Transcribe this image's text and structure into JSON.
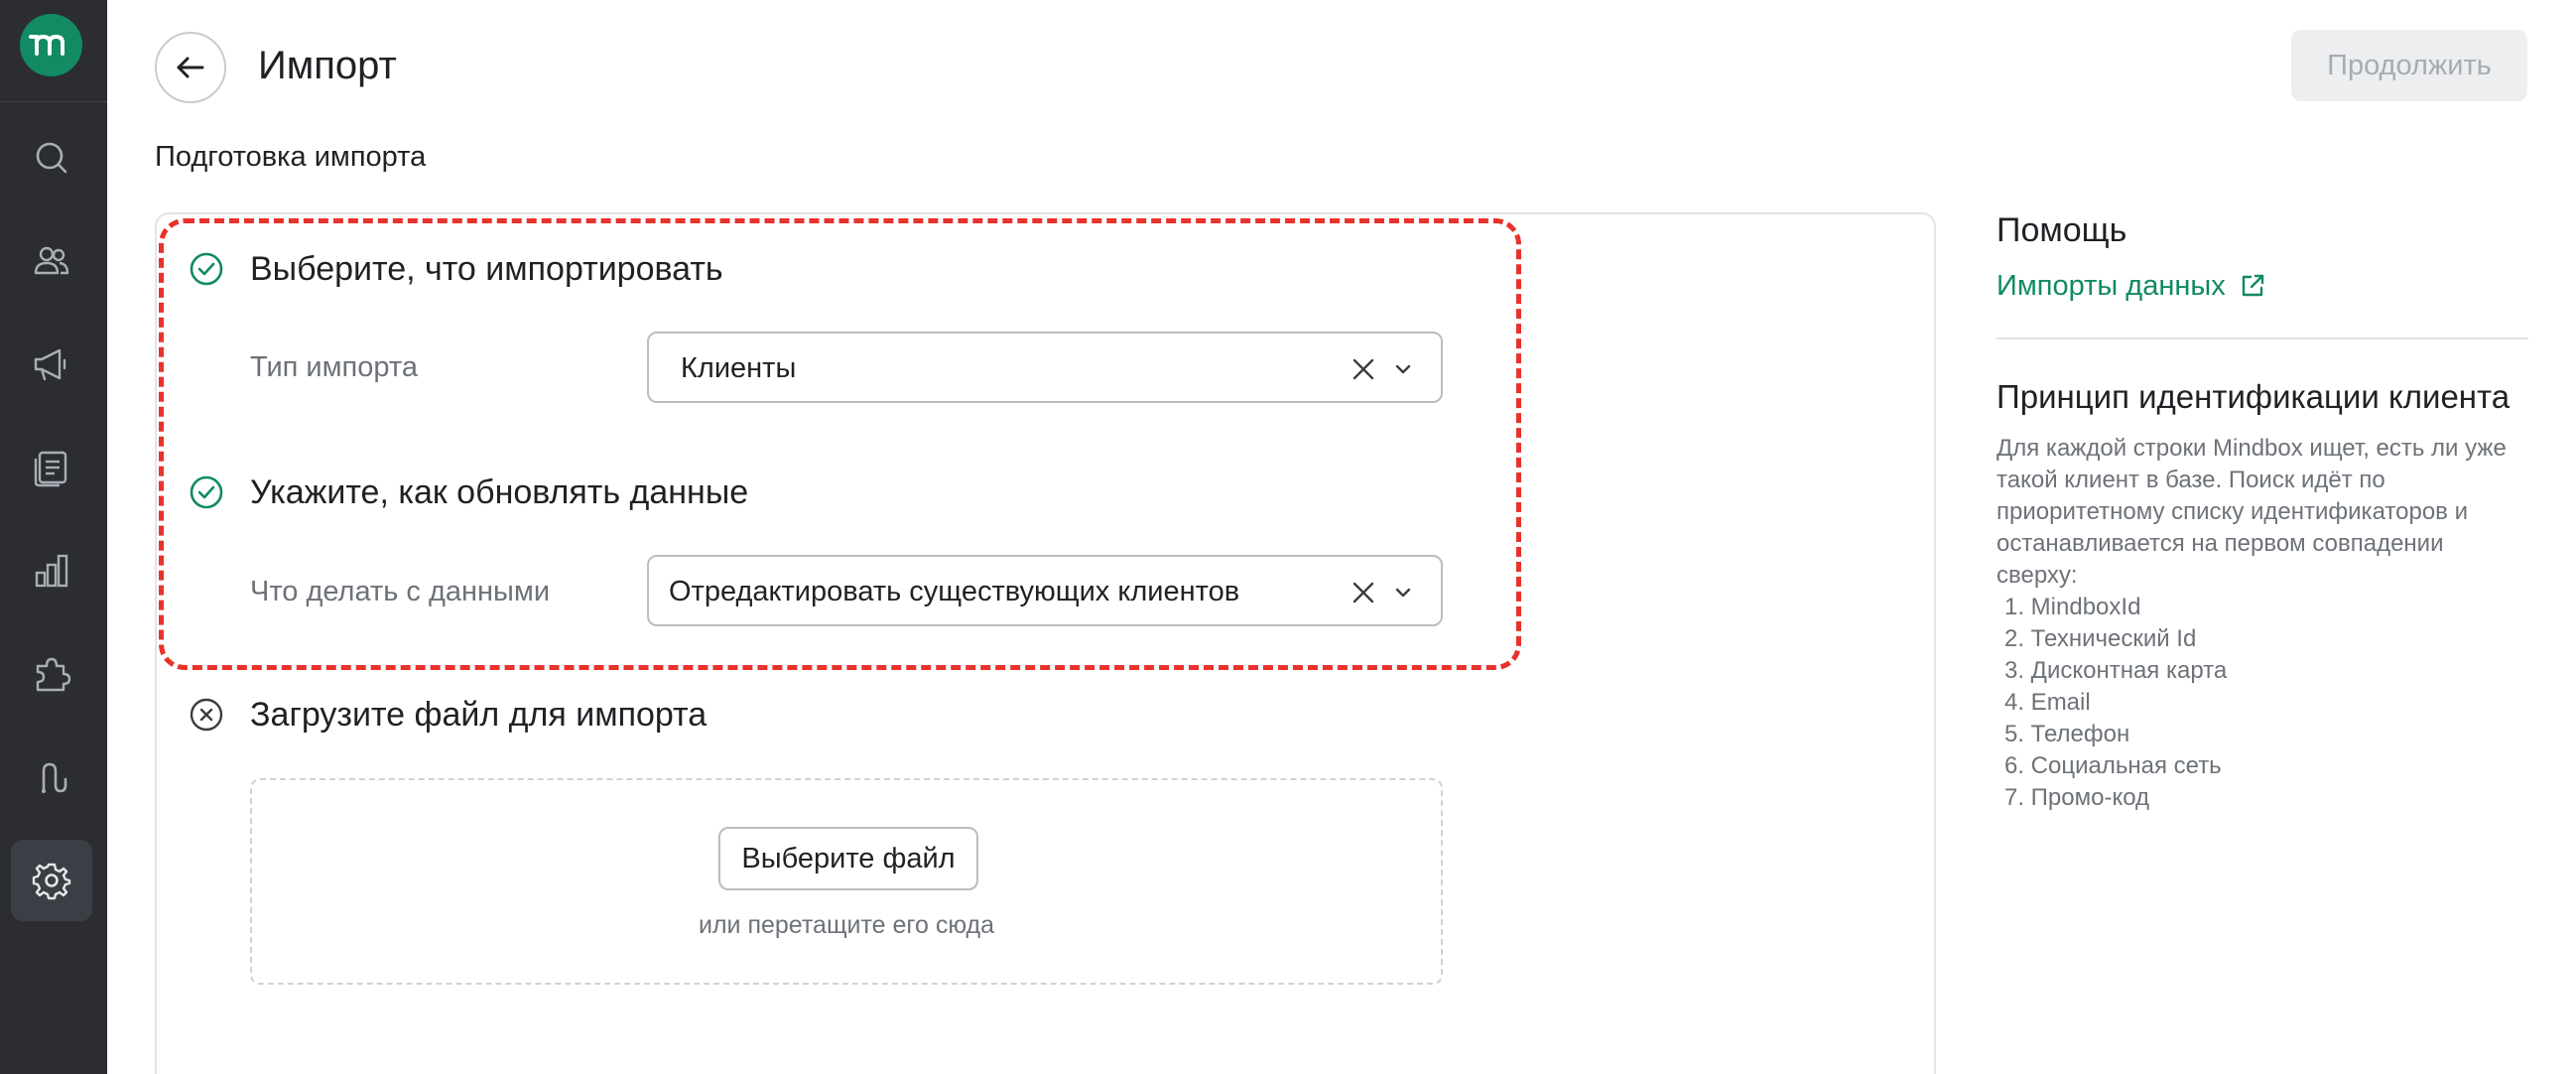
{
  "header": {
    "title": "Импорт",
    "continue_label": "Продолжить"
  },
  "subtitle": "Подготовка импорта",
  "steps": [
    {
      "title": "Выберите, что импортировать",
      "status": "done",
      "field_label": "Тип импорта",
      "field_value": "Клиенты"
    },
    {
      "title": "Укажите, как обновлять данные",
      "status": "done",
      "field_label": "Что делать с данными",
      "field_value": "Отредактировать существующих клиентов"
    },
    {
      "title": "Загрузите файл для импорта",
      "status": "pending",
      "upload_button": "Выберите файл",
      "upload_hint": "или перетащите его сюда"
    }
  ],
  "help": {
    "title": "Помощь",
    "link_label": "Импорты данных",
    "principle_title": "Принцип идентификации клиента",
    "principle_text": "Для каждой строки Mindbox ищет, есть ли уже такой клиент в базе. Поиск идёт по приоритетному списку идентификаторов и останавливается на первом совпадении сверху:",
    "identifiers": [
      "1. MindboxId",
      "2. Технический Id",
      "3. Дисконтная карта",
      "4. Email",
      "5. Телефон",
      "6. Социальная сеть",
      "7. Промо-код"
    ]
  },
  "sidebar": {
    "items": [
      "search-icon",
      "customers-icon",
      "campaigns-icon",
      "content-icon",
      "analytics-icon",
      "integrations-icon",
      "automation-icon",
      "settings-icon"
    ],
    "active": "settings-icon"
  },
  "colors": {
    "brand": "#128a63",
    "sidebar": "#2b2d31",
    "highlight": "#e8322b",
    "link": "#118a60"
  }
}
